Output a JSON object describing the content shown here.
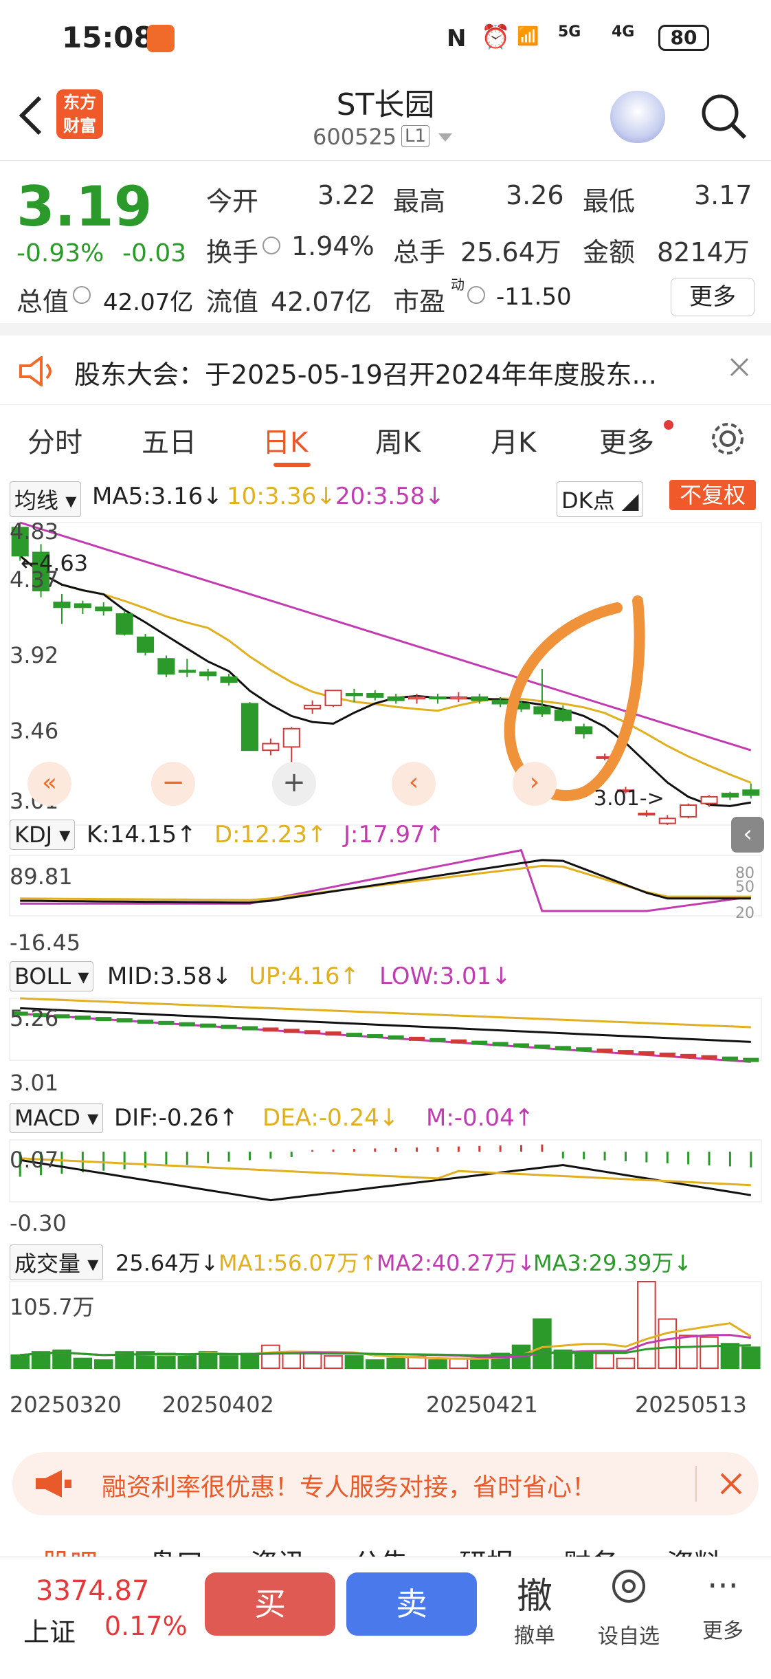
{
  "status": {
    "time": "15:08",
    "battery": "80",
    "net1": "5G",
    "net2": "4G",
    "wifi_tag": "6"
  },
  "nav": {
    "logo": "东方财富",
    "title": "ST长园",
    "code": "600525",
    "level": "L1"
  },
  "quote": {
    "price": "3.19",
    "change_pct": "-0.93%",
    "change": "-0.03",
    "open_label": "今开",
    "open": "3.22",
    "high_label": "最高",
    "high": "3.26",
    "low_label": "最低",
    "low": "3.17",
    "turnover_label": "换手",
    "turnover": "1.94%",
    "volume_label": "总手",
    "volume": "25.64万",
    "amount_label": "金额",
    "amount": "8214万",
    "mcap_label": "总值",
    "mcap": "42.07亿",
    "float_label": "流值",
    "float": "42.07亿",
    "pe_label": "市盈",
    "pe_sup": "动",
    "pe": "-11.50",
    "more": "更多"
  },
  "notice": {
    "text": "股东大会：于2025-05-19召开2024年年度股东..."
  },
  "tabs": [
    "分时",
    "五日",
    "日K",
    "周K",
    "月K",
    "更多"
  ],
  "active_tab": "日K",
  "ma": {
    "select": "均线",
    "ma5": "MA5:3.16↓",
    "ma10": "10:3.36↓",
    "ma20": "20:3.58↓",
    "dk": "DK点",
    "fq": "不复权",
    "y_labels": [
      "4.83",
      "4.37",
      "3.92",
      "3.46",
      "3.01"
    ],
    "hi_mark": "←4.63",
    "lo_mark": "3.01->"
  },
  "kdj": {
    "select": "KDJ",
    "k": "K:14.15↑",
    "d": "D:12.23↑",
    "j": "J:17.97↑",
    "y_top": "89.81",
    "y_bot": "-16.45",
    "r1": "80",
    "r2": "50",
    "r3": "20"
  },
  "boll": {
    "select": "BOLL",
    "mid": "MID:3.58↓",
    "up": "UP:4.16↑",
    "low": "LOW:3.01↓",
    "y_top": "5.26",
    "y_bot": "3.01"
  },
  "macd": {
    "select": "MACD",
    "dif": "DIF:-0.26↑",
    "dea": "DEA:-0.24↓",
    "m": "M:-0.04↑",
    "y_top": "0.07",
    "y_bot": "-0.30"
  },
  "vol": {
    "select": "成交量",
    "v": "25.64万↓",
    "ma1": "MA1:56.07万↑",
    "ma2": "MA2:40.27万↓",
    "ma3": "MA3:29.39万↓",
    "y_top": "105.7万"
  },
  "dates": [
    "20250320",
    "20250402",
    "20250421",
    "20250513"
  ],
  "ad": {
    "text": "融资利率很优惠！专人服务对接，省时省心！"
  },
  "bottom_tabs": [
    "股吧",
    "盘口",
    "资讯",
    "公告",
    "研报",
    "财务",
    "资料"
  ],
  "index": {
    "value": "3374.87",
    "name": "上证",
    "pct": "0.17%"
  },
  "actions": {
    "buy": "买",
    "sell": "卖",
    "cancel_icon": "撤",
    "cancel": "撤单",
    "fav": "设自选",
    "more": "更多"
  },
  "chart_data": {
    "type": "candlestick",
    "candles": [
      {
        "o": 4.8,
        "c": 4.63,
        "h": 4.83,
        "l": 4.6
      },
      {
        "o": 4.65,
        "c": 4.42,
        "h": 4.7,
        "l": 4.38
      },
      {
        "o": 4.35,
        "c": 4.32,
        "h": 4.4,
        "l": 4.22
      },
      {
        "o": 4.34,
        "c": 4.32,
        "h": 4.36,
        "l": 4.28
      },
      {
        "o": 4.32,
        "c": 4.3,
        "h": 4.35,
        "l": 4.27
      },
      {
        "o": 4.28,
        "c": 4.16,
        "h": 4.3,
        "l": 4.15
      },
      {
        "o": 4.14,
        "c": 4.05,
        "h": 4.16,
        "l": 4.03
      },
      {
        "o": 4.01,
        "c": 3.92,
        "h": 4.03,
        "l": 3.9
      },
      {
        "o": 3.94,
        "c": 3.93,
        "h": 4.01,
        "l": 3.9
      },
      {
        "o": 3.93,
        "c": 3.91,
        "h": 3.95,
        "l": 3.88
      },
      {
        "o": 3.9,
        "c": 3.87,
        "h": 3.92,
        "l": 3.85
      },
      {
        "o": 3.74,
        "c": 3.46,
        "h": 3.75,
        "l": 3.46
      },
      {
        "o": 3.46,
        "c": 3.5,
        "h": 3.53,
        "l": 3.43
      },
      {
        "o": 3.48,
        "c": 3.59,
        "h": 3.6,
        "l": 3.36
      },
      {
        "o": 3.71,
        "c": 3.73,
        "h": 3.76,
        "l": 3.68
      },
      {
        "o": 3.73,
        "c": 3.82,
        "h": 3.82,
        "l": 3.72
      },
      {
        "o": 3.8,
        "c": 3.79,
        "h": 3.83,
        "l": 3.75
      },
      {
        "o": 3.8,
        "c": 3.78,
        "h": 3.82,
        "l": 3.76
      },
      {
        "o": 3.78,
        "c": 3.76,
        "h": 3.8,
        "l": 3.74
      },
      {
        "o": 3.77,
        "c": 3.78,
        "h": 3.8,
        "l": 3.74
      },
      {
        "o": 3.78,
        "c": 3.77,
        "h": 3.8,
        "l": 3.74
      },
      {
        "o": 3.77,
        "c": 3.78,
        "h": 3.81,
        "l": 3.75
      },
      {
        "o": 3.78,
        "c": 3.76,
        "h": 3.8,
        "l": 3.74
      },
      {
        "o": 3.76,
        "c": 3.74,
        "h": 3.78,
        "l": 3.72
      },
      {
        "o": 3.74,
        "c": 3.71,
        "h": 3.76,
        "l": 3.69
      },
      {
        "o": 3.72,
        "c": 3.68,
        "h": 3.95,
        "l": 3.66
      },
      {
        "o": 3.7,
        "c": 3.64,
        "h": 3.73,
        "l": 3.63
      },
      {
        "o": 3.6,
        "c": 3.56,
        "h": 3.62,
        "l": 3.53
      },
      {
        "o": 3.42,
        "c": 3.42,
        "h": 3.44,
        "l": 3.4
      },
      {
        "o": 3.22,
        "c": 3.22,
        "h": 3.24,
        "l": 3.2
      },
      {
        "o": 3.08,
        "c": 3.08,
        "h": 3.1,
        "l": 3.06
      },
      {
        "o": 3.02,
        "c": 3.05,
        "h": 3.07,
        "l": 3.01
      },
      {
        "o": 3.06,
        "c": 3.13,
        "h": 3.14,
        "l": 3.05
      },
      {
        "o": 3.14,
        "c": 3.18,
        "h": 3.19,
        "l": 3.12
      },
      {
        "o": 3.2,
        "c": 3.18,
        "h": 3.21,
        "l": 3.16
      },
      {
        "o": 3.22,
        "c": 3.19,
        "h": 3.26,
        "l": 3.17
      }
    ],
    "ylim": [
      3.01,
      4.83
    ]
  }
}
